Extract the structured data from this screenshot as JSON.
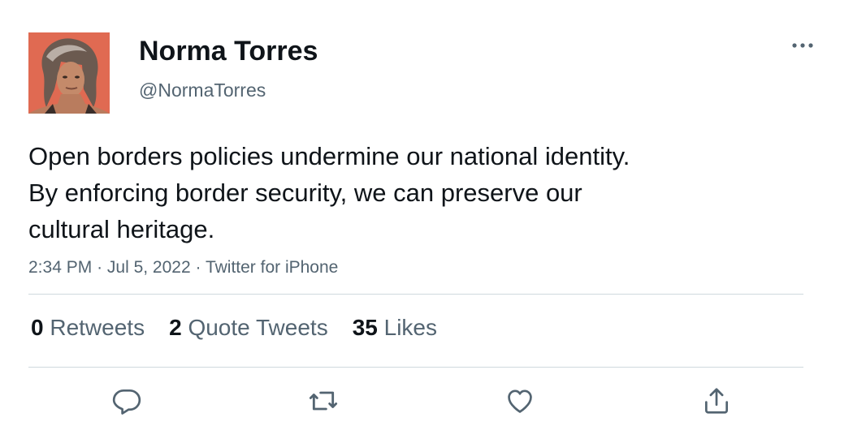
{
  "author": {
    "display_name": "Norma Torres",
    "handle": "@NormaTorres",
    "avatar_icon": "profile-photo"
  },
  "tweet": {
    "lines": [
      "Open borders policies undermine our national identity.",
      "By enforcing border security, we can preserve our",
      "cultural heritage."
    ],
    "time": "2:34 PM",
    "date": "Jul 5, 2022",
    "source": "Twitter for iPhone"
  },
  "stats": {
    "retweets_count": "0",
    "retweets_label": "Retweets",
    "quotes_count": "2",
    "quotes_label": "Quote Tweets",
    "likes_count": "35",
    "likes_label": "Likes"
  },
  "actions": {
    "icons": [
      "reply-icon",
      "retweet-icon",
      "like-icon",
      "share-icon"
    ]
  },
  "colors": {
    "text_primary": "#0f1419",
    "text_secondary": "#536471",
    "divider": "#cfd9de",
    "avatar_bg": "#e06a52"
  }
}
